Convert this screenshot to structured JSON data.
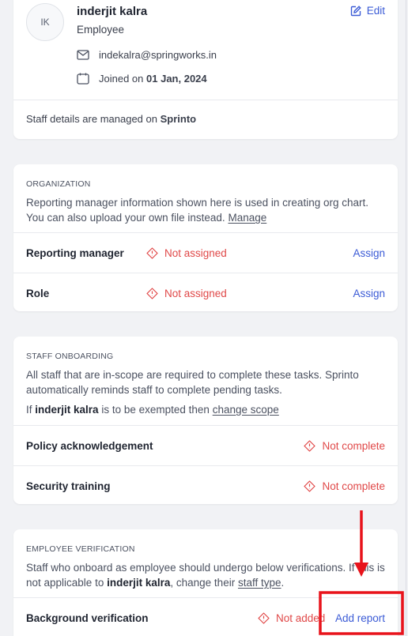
{
  "profile": {
    "initials": "IK",
    "name": "inderjit kalra",
    "role": "Employee",
    "email": "indekalra@springworks.in",
    "joined_prefix": "Joined on",
    "joined_date": "01 Jan, 2024",
    "edit_label": "Edit",
    "managed_prefix": "Staff details are managed on",
    "managed_by": "Sprinto"
  },
  "organization": {
    "heading": "ORGANIZATION",
    "desc_line1": "Reporting manager information shown here is used in creating org chart.",
    "desc_line2_prefix": "You can also upload your own file instead.",
    "manage_link": "Manage",
    "rows": [
      {
        "label": "Reporting manager",
        "status": "Not assigned",
        "action": "Assign"
      },
      {
        "label": "Role",
        "status": "Not assigned",
        "action": "Assign"
      }
    ]
  },
  "onboarding": {
    "heading": "STAFF ONBOARDING",
    "desc": "All staff that are in-scope are required to complete these tasks. Sprinto automatically reminds staff to complete pending tasks.",
    "exempt_prefix": "If",
    "exempt_name": "inderjit kalra",
    "exempt_mid": "is to be exempted then",
    "exempt_link": "change scope",
    "rows": [
      {
        "label": "Policy acknowledgement",
        "status": "Not complete"
      },
      {
        "label": "Security training",
        "status": "Not complete"
      }
    ]
  },
  "verification": {
    "heading": "EMPLOYEE VERIFICATION",
    "desc_line1": "Staff who onboard as employee should undergo below verifications. If this is",
    "desc_line2_prefix": "not applicable to",
    "desc_name": "inderjit kalra",
    "desc_line2_mid": ", change their",
    "desc_link": "staff type",
    "desc_end": ".",
    "rows": [
      {
        "label": "Background verification",
        "status": "Not added",
        "action": "Add report"
      }
    ]
  },
  "colors": {
    "accent": "#3b5bd6",
    "danger": "#e04848",
    "annotation": "#e8131b"
  }
}
